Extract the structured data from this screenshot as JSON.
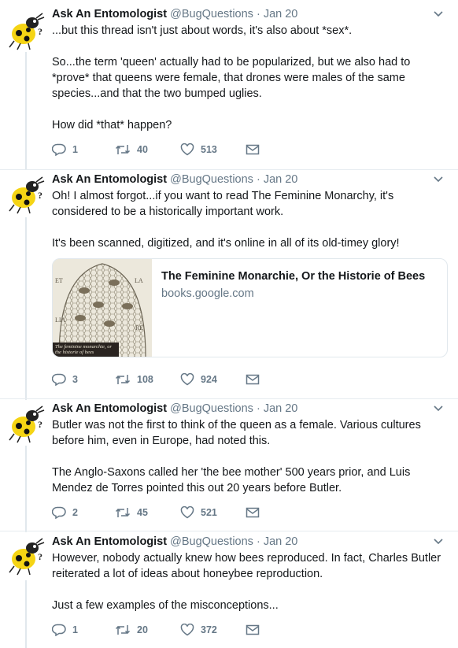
{
  "tweets": [
    {
      "name": "Ask An Entomologist",
      "handle": "@BugQuestions",
      "date": "Jan 20",
      "paragraphs": [
        "...but this thread isn't just about words, it's also about *sex*.",
        "So...the term 'queen' actually had to be popularized, but we also had to *prove* that queens were female, that drones were males of the same species...and that the two bumped uglies.",
        "How did *that* happen?"
      ],
      "replies": "1",
      "retweets": "40",
      "likes": "513"
    },
    {
      "name": "Ask An Entomologist",
      "handle": "@BugQuestions",
      "date": "Jan 20",
      "paragraphs": [
        "Oh! I almost forgot...if you want to read The Feminine Monarchy, it's considered to be a historically important work.",
        "It's been scanned, digitized, and it's online in all of its old-timey glory!"
      ],
      "card": {
        "title": "The Feminine Monarchie, Or the Historie of Bees",
        "domain": "books.google.com",
        "image_caption": "The feminine monarchie, or the historie of bees"
      },
      "replies": "3",
      "retweets": "108",
      "likes": "924"
    },
    {
      "name": "Ask An Entomologist",
      "handle": "@BugQuestions",
      "date": "Jan 20",
      "paragraphs": [
        "Butler was not the first to think of the queen as a female. Various cultures before him, even in Europe, had noted this.",
        "The Anglo-Saxons called her 'the bee mother' 500 years prior, and Luis Mendez de Torres pointed this out 20 years before Butler."
      ],
      "replies": "2",
      "retweets": "45",
      "likes": "521"
    },
    {
      "name": "Ask An Entomologist",
      "handle": "@BugQuestions",
      "date": "Jan 20",
      "paragraphs": [
        "However, nobody actually knew how bees reproduced. In fact, Charles Butler reiterated a lot of ideas about honeybee reproduction.",
        "Just a few examples of the misconceptions..."
      ],
      "replies": "1",
      "retweets": "20",
      "likes": "372"
    }
  ],
  "separator": "·",
  "icons": {
    "reply": "reply-icon",
    "retweet": "retweet-icon",
    "like": "heart-icon",
    "dm": "envelope-icon",
    "more": "chevron-down-icon",
    "avatar": "bug-avatar"
  },
  "colors": {
    "text": "#14171a",
    "muted": "#657786",
    "border": "#e6ecf0",
    "avatar_yellow": "#f5d414"
  }
}
